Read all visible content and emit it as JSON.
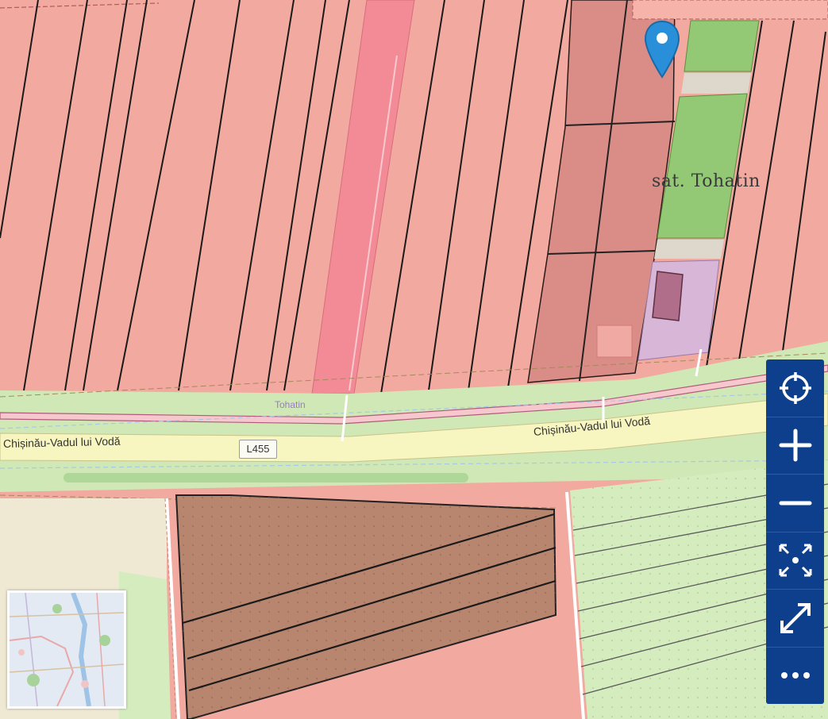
{
  "map": {
    "settlement_label": "sat. Tohatin",
    "place_label": "Tohatin",
    "road_label_left": "Chișinău-Vadul lui Vodă",
    "road_label_right": "Chișinău-Vadul lui Vodă",
    "road_ref": "L455"
  },
  "controls": [
    {
      "name": "locate-button",
      "icon": "crosshair-icon"
    },
    {
      "name": "zoom-in-button",
      "icon": "plus-icon"
    },
    {
      "name": "zoom-out-button",
      "icon": "minus-icon"
    },
    {
      "name": "fit-extent-button",
      "icon": "fit-extent-icon"
    },
    {
      "name": "fullscreen-button",
      "icon": "expand-arrows-icon"
    },
    {
      "name": "more-button",
      "icon": "ellipsis-icon"
    }
  ],
  "colors": {
    "parcel_pink": "#f2a99f",
    "parcel_dark_pink": "#d98d86",
    "road_yellow": "#f7f6c0",
    "grass_green": "#cfe8b5",
    "field_green": "#93c974",
    "brown_parcel": "#b8856f",
    "residential_purple": "#d7b6d8",
    "control_blue": "#0e3f8c",
    "pin_blue": "#2a8fd9"
  }
}
